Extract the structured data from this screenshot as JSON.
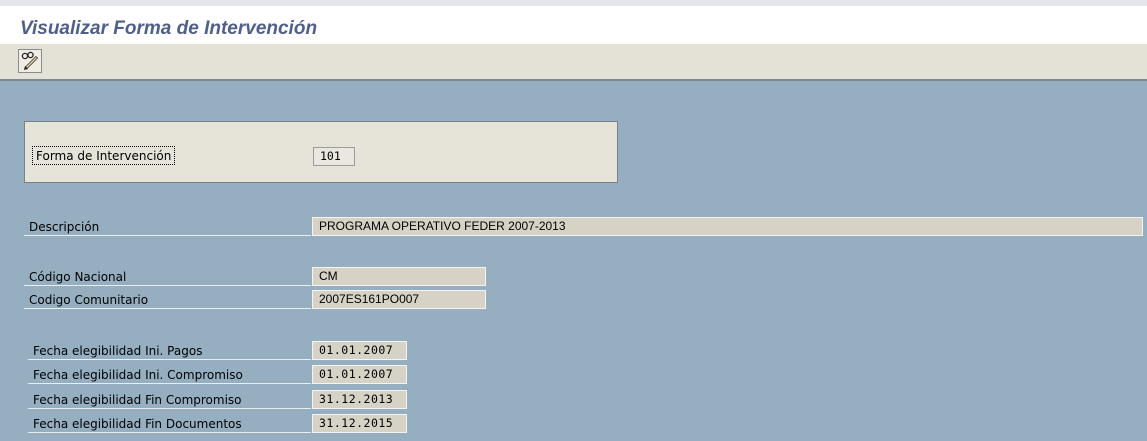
{
  "window": {
    "title": "Visualizar Forma de Intervención"
  },
  "toolbar": {
    "edit_icon": "pencil-glasses-icon"
  },
  "key": {
    "label": "Forma de Intervención",
    "value": "101"
  },
  "fields": {
    "descripcion": {
      "label": "Descripción",
      "value": "PROGRAMA OPERATIVO FEDER 2007-2013"
    },
    "codigo_nacional": {
      "label": "Código Nacional",
      "value": "CM"
    },
    "codigo_comunitario": {
      "label": "Codigo Comunitario",
      "value": "2007ES161PO007"
    },
    "ini_pagos": {
      "label": "Fecha elegibilidad Ini. Pagos",
      "value": "01.01.2007"
    },
    "ini_compromiso": {
      "label": "Fecha elegibilidad Ini. Compromiso",
      "value": "01.01.2007"
    },
    "fin_compromiso": {
      "label": "Fecha elegibilidad Fin Compromiso",
      "value": "31.12.2013"
    },
    "fin_documentos": {
      "label": "Fecha elegibilidad Fin Documentos",
      "value": "31.12.2015"
    }
  }
}
